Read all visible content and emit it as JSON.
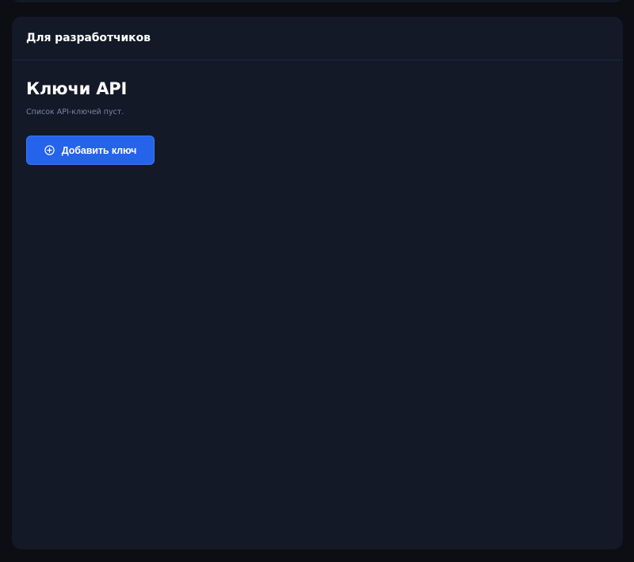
{
  "card": {
    "header_title": "Для разработчиков"
  },
  "api_keys": {
    "title": "Ключи API",
    "empty_text": "Список API-ключей пуст.",
    "add_button_label": "Добавить ключ",
    "add_button_icon": "plus-circle-icon"
  },
  "colors": {
    "page_background": "#0d0d14",
    "card_background": "#131927",
    "primary_button": "#2563eb",
    "muted_text": "#7c86a2"
  }
}
